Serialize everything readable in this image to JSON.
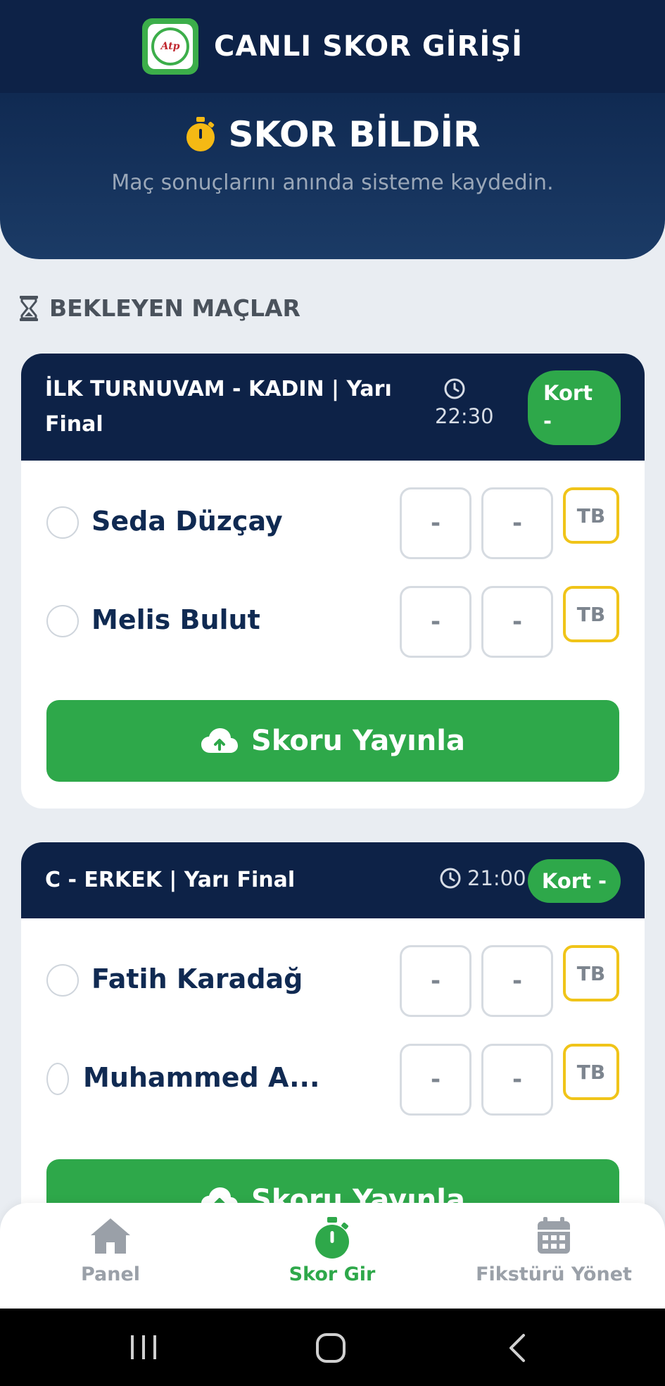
{
  "app": {
    "title": "CANLI SKOR GİRİŞİ",
    "logo_text": "Atp"
  },
  "hero": {
    "title": "SKOR BİLDİR",
    "subtitle": "Maç sonuçlarını anında sisteme kaydedin."
  },
  "section": {
    "title": "BEKLEYEN MAÇLAR"
  },
  "matches": [
    {
      "title_line1": "İLK TURNUVAM - KADIN | Yarı",
      "title_line2": "Final",
      "time": "22:30",
      "court_line1": "Kort",
      "court_line2": "-",
      "players": [
        {
          "name": "Seda Düzçay",
          "set1": "-",
          "set2": "-",
          "tb": "TB"
        },
        {
          "name": "Melis Bulut",
          "set1": "-",
          "set2": "-",
          "tb": "TB"
        }
      ],
      "publish_label": "Skoru Yayınla"
    },
    {
      "title_line1": "C - ERKEK | Yarı Final",
      "time": "21:00",
      "court": "Kort -",
      "players": [
        {
          "name": "Fatih Karadağ",
          "set1": "-",
          "set2": "-",
          "tb": "TB"
        },
        {
          "name": "Muhammed A...",
          "set1": "-",
          "set2": "-",
          "tb": "TB"
        }
      ],
      "publish_label": "Skoru Yayınla"
    }
  ],
  "nav": [
    {
      "label": "Panel",
      "icon": "home-icon",
      "active": false
    },
    {
      "label": "Skor Gir",
      "icon": "stopwatch-icon",
      "active": true
    },
    {
      "label": "Fikstürü Yönet",
      "icon": "calendar-icon",
      "active": false
    }
  ],
  "colors": {
    "navy": "#0d2247",
    "green": "#2ea84a",
    "gold": "#f0c419",
    "muted": "#9aa0a8"
  }
}
